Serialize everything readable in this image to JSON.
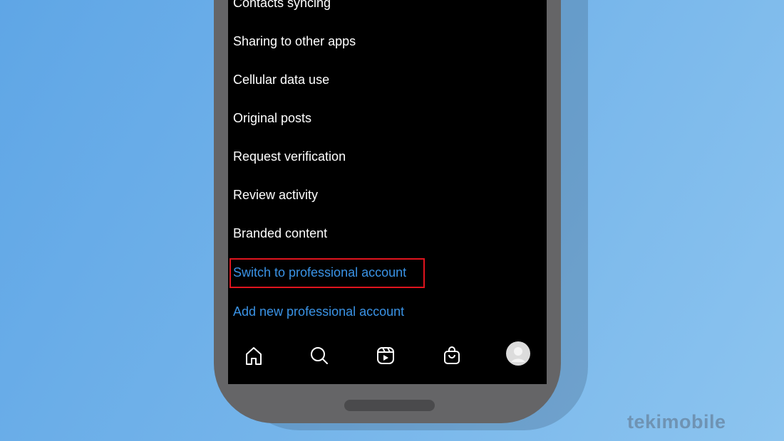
{
  "settings_items": [
    {
      "label": "Contacts syncing",
      "color": "#ffffff"
    },
    {
      "label": "Sharing to other apps",
      "color": "#ffffff"
    },
    {
      "label": "Cellular data use",
      "color": "#ffffff"
    },
    {
      "label": "Original posts",
      "color": "#ffffff"
    },
    {
      "label": "Request verification",
      "color": "#ffffff"
    },
    {
      "label": "Review activity",
      "color": "#ffffff"
    },
    {
      "label": "Branded content",
      "color": "#ffffff"
    },
    {
      "label": "Switch to professional account",
      "color": "#3a93e6",
      "highlighted": true
    },
    {
      "label": "Add new professional account",
      "color": "#3a93e6"
    }
  ],
  "highlight_color": "#e0141e",
  "bottom_nav": [
    "home-icon",
    "search-icon",
    "reels-icon",
    "shop-icon",
    "profile-avatar"
  ],
  "watermark": "tekimobile"
}
